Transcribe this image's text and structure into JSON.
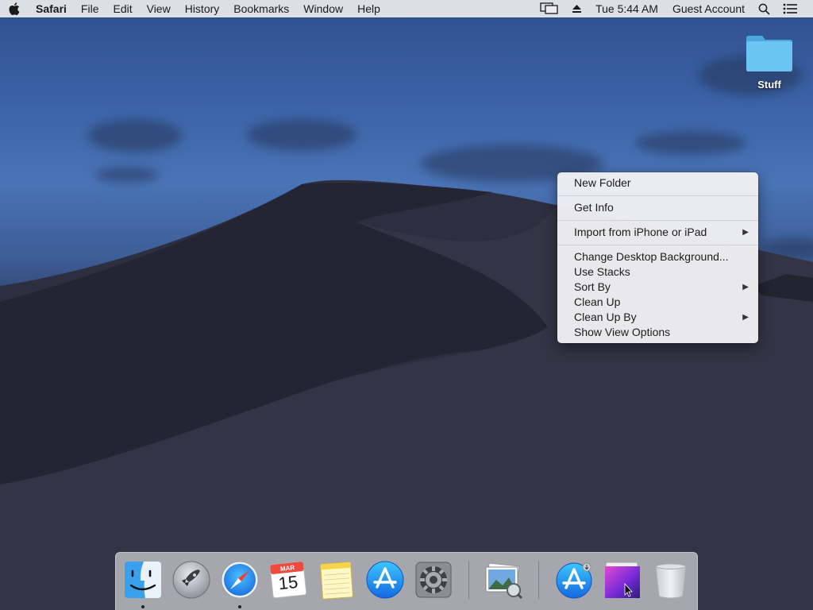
{
  "menubar": {
    "apple_icon": "apple-icon",
    "app_name": "Safari",
    "menus": [
      "File",
      "Edit",
      "View",
      "History",
      "Bookmarks",
      "Window",
      "Help"
    ],
    "status": {
      "display_icon": "display-mirroring-icon",
      "eject_icon": "eject-icon",
      "clock": "Tue 5:44 AM",
      "user": "Guest Account",
      "search_icon": "spotlight-search-icon",
      "notification_icon": "notification-center-icon"
    }
  },
  "desktop": {
    "folder": {
      "label": "Stuff",
      "icon": "folder-icon",
      "color": "#6cc4f2"
    }
  },
  "context_menu": {
    "items": [
      {
        "label": "New Folder",
        "submenu": false,
        "separator_after": true
      },
      {
        "label": "Get Info",
        "submenu": false,
        "separator_after": true
      },
      {
        "label": "Import from iPhone or iPad",
        "submenu": true,
        "separator_after": true
      },
      {
        "label": "Change Desktop Background...",
        "submenu": false,
        "separator_after": false
      },
      {
        "label": "Use Stacks",
        "submenu": false,
        "separator_after": false
      },
      {
        "label": "Sort By",
        "submenu": true,
        "separator_after": false
      },
      {
        "label": "Clean Up",
        "submenu": false,
        "separator_after": false
      },
      {
        "label": "Clean Up By",
        "submenu": true,
        "separator_after": false
      },
      {
        "label": "Show View Options",
        "submenu": false,
        "separator_after": false
      }
    ],
    "submenu_arrow": "▶"
  },
  "dock": {
    "apps": [
      {
        "name": "finder",
        "icon": "finder-icon",
        "running": true
      },
      {
        "name": "launchpad",
        "icon": "launchpad-rocket-icon",
        "running": false
      },
      {
        "name": "safari",
        "icon": "safari-compass-icon",
        "running": true
      },
      {
        "name": "calendar",
        "icon": "calendar-icon",
        "running": false,
        "month": "MAR",
        "day": "15"
      },
      {
        "name": "notes",
        "icon": "notes-icon",
        "running": false
      },
      {
        "name": "app-store",
        "icon": "app-store-icon",
        "running": false
      },
      {
        "name": "system-preferences",
        "icon": "system-preferences-gear-icon",
        "running": false
      },
      {
        "name": "preview",
        "icon": "preview-photos-icon",
        "running": false
      },
      {
        "name": "app-store-download",
        "icon": "app-store-download-icon",
        "running": false
      },
      {
        "name": "macos-installer",
        "icon": "macos-installer-icon",
        "running": false
      },
      {
        "name": "trash",
        "icon": "trash-icon",
        "running": false
      }
    ]
  }
}
